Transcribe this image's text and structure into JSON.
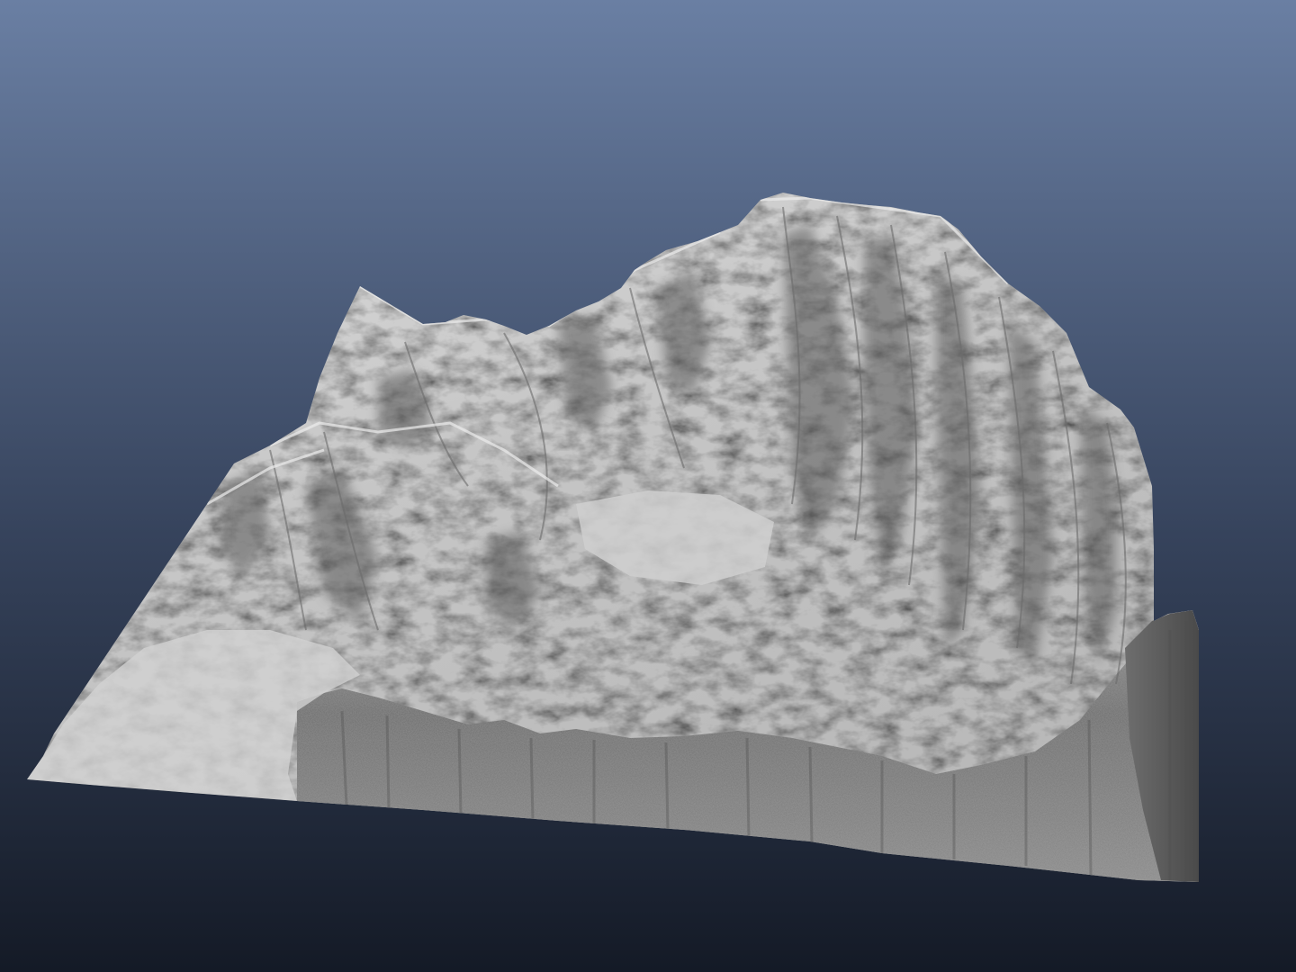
{
  "scene": {
    "subject": "terrain-mesh",
    "background": {
      "top_color": "#6a7fa3",
      "bottom_color": "#141a26"
    },
    "terrain": {
      "material": "grey-clay",
      "light_color": "#d8d8d8",
      "mid_color": "#a8a8a8",
      "shadow_color": "#4a4a4a",
      "side_color": "#5c5c5c"
    }
  }
}
